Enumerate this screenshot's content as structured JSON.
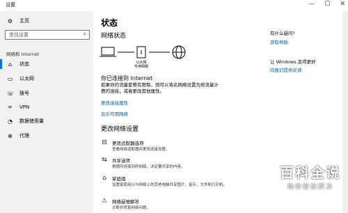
{
  "window": {
    "title": "设置",
    "min": "—",
    "max": "☐",
    "close": "✕"
  },
  "sidebar": {
    "home": "主页",
    "search_placeholder": "查找设置",
    "section": "网络和 Internet",
    "items": [
      {
        "label": "状态",
        "icon": "home-icon"
      },
      {
        "label": "以太网",
        "icon": "ethernet-icon"
      },
      {
        "label": "拨号",
        "icon": "dialup-icon"
      },
      {
        "label": "VPN",
        "icon": "vpn-icon"
      },
      {
        "label": "数据使用量",
        "icon": "data-usage-icon"
      },
      {
        "label": "代理",
        "icon": "proxy-icon"
      }
    ]
  },
  "main": {
    "page_title": "状态",
    "network_status": "网络状态",
    "router_label_1": "以太网",
    "router_label_2": "专用网络",
    "connected_title": "你已连接到 Internet",
    "connected_desc_1": "如果你的流量套餐有限制，则可以将此网络设置为按流量计",
    "connected_desc_2": "费的连接，或者更改其他属性。",
    "link_change_props": "更改连接属性",
    "link_show_networks": "显示可用网络",
    "change_settings": "更改网络设置",
    "options": [
      {
        "title": "更改适配器选项",
        "desc": "查看网络适配器并更改连接设置。",
        "icon": "adapter-icon"
      },
      {
        "title": "共享选项",
        "desc": "根据所连接到的网络，决定要共享的内容。",
        "icon": "sharing-icon"
      },
      {
        "title": "家庭组",
        "desc": "设置家庭组以与网络上的其他电脑共享图片、音乐、文件和打印机。",
        "icon": "homegroup-icon"
      },
      {
        "title": "网络疑难解答",
        "desc": "诊断并修复网络问题。",
        "icon": "troubleshoot-icon"
      }
    ]
  },
  "right": {
    "q_title": "有什么疑问?",
    "q_link": "获取帮助",
    "better_title": "让 Windows 变得更好",
    "better_link": "向我们提供反馈"
  },
  "watermark": {
    "line1": "百科全说",
    "line2": "助你轻松解决"
  },
  "colors": {
    "accent": "#0078d7",
    "link": "#0063b1",
    "sidebar_bg": "#f2f2f2"
  }
}
